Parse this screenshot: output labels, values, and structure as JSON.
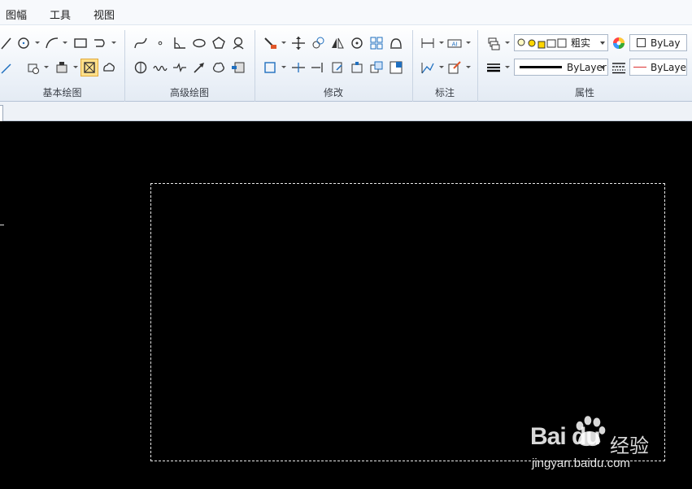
{
  "menu": {
    "items": [
      "图幅",
      "工具",
      "视图"
    ]
  },
  "ribbon": {
    "panels": {
      "basic_draw": "基本绘图",
      "advanced_draw": "高级绘图",
      "modify": "修改",
      "annotate": "标注",
      "properties": "属性"
    }
  },
  "properties": {
    "layer_combo": "粗实",
    "color_combo": "ByLay",
    "linetype_combo": "ByLayer",
    "lineweight_combo": "ByLaye"
  },
  "watermark": {
    "logo": "Bai  du",
    "label": "经验",
    "url": "jingyan.baidu.com"
  },
  "colors": {
    "canvas": "#000000",
    "ribbon": "#eef3f9",
    "accent": "#1f6fbf",
    "active_tool": "#ffe08a"
  }
}
